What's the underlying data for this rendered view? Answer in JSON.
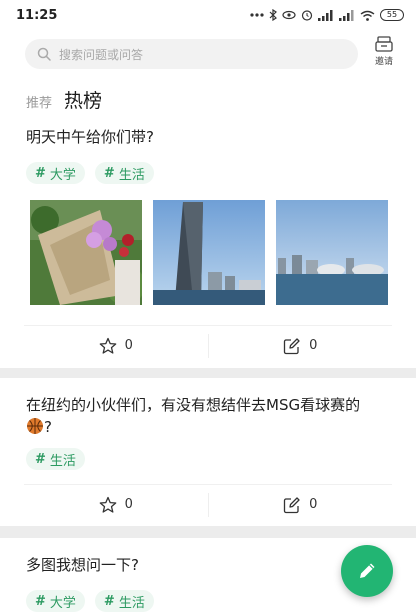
{
  "status_bar": {
    "time": "11:25",
    "battery": "55"
  },
  "header": {
    "search_placeholder": "搜索问题或问答",
    "invite_label": "邀请"
  },
  "tabs": {
    "recommend": "推荐",
    "hot": "热榜"
  },
  "questions": [
    {
      "title": "明天中午给你们带?",
      "tags": [
        "大学",
        "生活"
      ],
      "star_count": "0",
      "answer_count": "0"
    },
    {
      "title": "在纽约的小伙伴们，有没有想结伴去MSG看球赛的",
      "title_suffix": "?",
      "tags": [
        "生活"
      ],
      "star_count": "0",
      "answer_count": "0"
    },
    {
      "title": "多图我想问一下?",
      "tags": [
        "大学",
        "生活"
      ]
    }
  ],
  "icons": {
    "search": "search-icon",
    "invite": "invite-icon",
    "star": "star-icon",
    "answer": "edit-answer-icon",
    "fab": "pencil-icon",
    "basketball": "basketball-emoji"
  },
  "colors": {
    "accent": "#22b573",
    "tag_text": "#2c9a61",
    "tag_bg": "#eef7f2"
  }
}
